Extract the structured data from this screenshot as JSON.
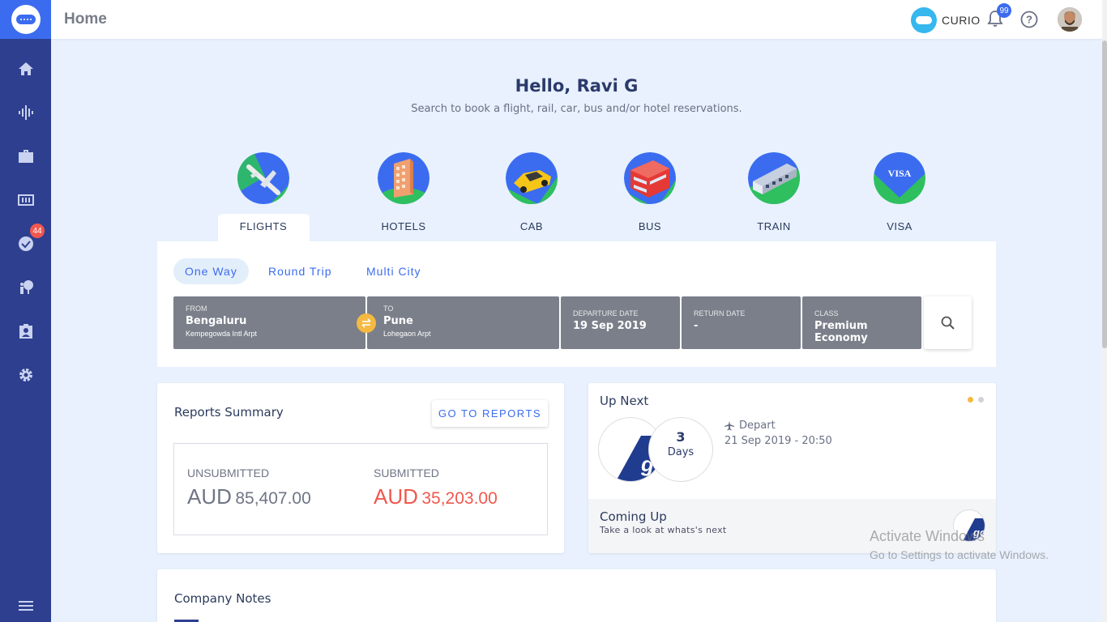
{
  "header": {
    "title": "Home",
    "brand_label": "CURIO",
    "notification_count": "99"
  },
  "sidebar": {
    "approvals_badge": "44",
    "items": [
      "home-icon",
      "activity-icon",
      "briefcase-icon",
      "tickets-icon",
      "approvals-icon",
      "travelers-icon",
      "profile-icon",
      "settings-icon",
      "menu-icon"
    ]
  },
  "greeting": {
    "title": "Hello, Ravi G",
    "subtitle": "Search to book a flight, rail, car, bus and/or hotel reservations."
  },
  "services": [
    {
      "label": "FLIGHTS"
    },
    {
      "label": "HOTELS"
    },
    {
      "label": "CAB"
    },
    {
      "label": "BUS"
    },
    {
      "label": "TRAIN"
    },
    {
      "label": "VISA",
      "icon_text": "VISA"
    }
  ],
  "trip_types": [
    "One Way",
    "Round Trip",
    "Multi City"
  ],
  "search": {
    "from": {
      "label": "FROM",
      "city": "Bengaluru",
      "airport": "Kempegowda Intl Arpt"
    },
    "to": {
      "label": "TO",
      "city": "Pune",
      "airport": "Lohegaon Arpt"
    },
    "departure": {
      "label": "DEPARTURE DATE",
      "value": "19 Sep 2019"
    },
    "return": {
      "label": "RETURN DATE",
      "value": "-"
    },
    "class": {
      "label": "CLASS",
      "value": "Premium Economy"
    }
  },
  "reports": {
    "title": "Reports Summary",
    "button": "GO TO REPORTS",
    "unsubmitted": {
      "label": "UNSUBMITTED",
      "currency": "AUD",
      "amount": "85,407.00"
    },
    "submitted": {
      "label": "SUBMITTED",
      "currency": "AUD",
      "amount": "35,203.00"
    }
  },
  "up_next": {
    "title": "Up Next",
    "days": "3",
    "days_label": "Days",
    "depart_label": "Depart",
    "depart_time": "21 Sep 2019 - 20:50",
    "coming_title": "Coming Up",
    "coming_sub": "Take a look at whats's next"
  },
  "notes": {
    "title": "Company Notes"
  },
  "watermark": {
    "title": "Activate Windows",
    "subtitle": "Go to Settings to activate Windows."
  },
  "colors": {
    "sidebar": "#2e3f8f",
    "accent": "#3b6cf0",
    "submitted": "#f0584f",
    "unsubmitted": "#6f7585"
  }
}
